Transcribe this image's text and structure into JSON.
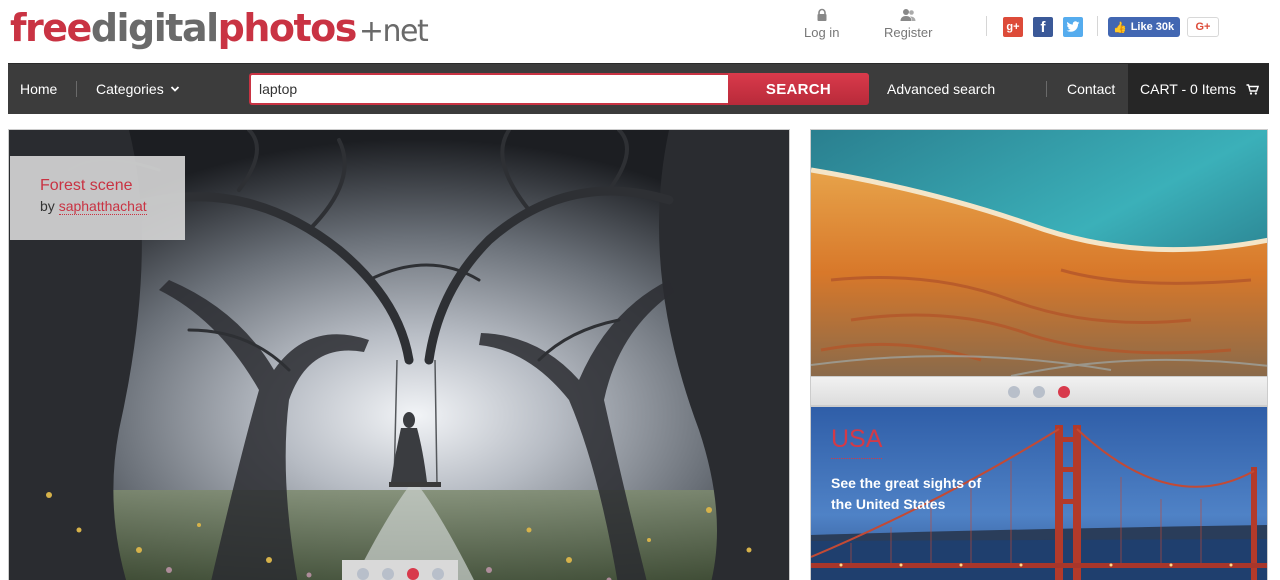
{
  "logo": {
    "part1": "free",
    "part2": "digital",
    "part3": "photos",
    "part4": "+net"
  },
  "header": {
    "login_label": "Log in",
    "register_label": "Register",
    "gplus_label": "g+",
    "facebook_label": "f",
    "twitter_label": "t",
    "fb_like_label": "Like 30k",
    "gplus_button_label": "G+"
  },
  "nav": {
    "home": "Home",
    "categories": "Categories",
    "search_value": "laptop",
    "search_button": "SEARCH",
    "advanced_search": "Advanced search",
    "contact": "Contact",
    "cart": "CART - 0 Items"
  },
  "hero": {
    "title": "Forest scene",
    "by_label": "by",
    "author": "saphatthachat",
    "dots": 4,
    "active_dot": 3
  },
  "side_top": {
    "dots": 3,
    "active_dot": 3
  },
  "side_bottom": {
    "title": "USA",
    "subtitle": "See the great sights of the United States"
  },
  "colors": {
    "brand_red": "#c93343",
    "nav_bg": "#3c3c3c",
    "cart_bg": "#262626"
  }
}
